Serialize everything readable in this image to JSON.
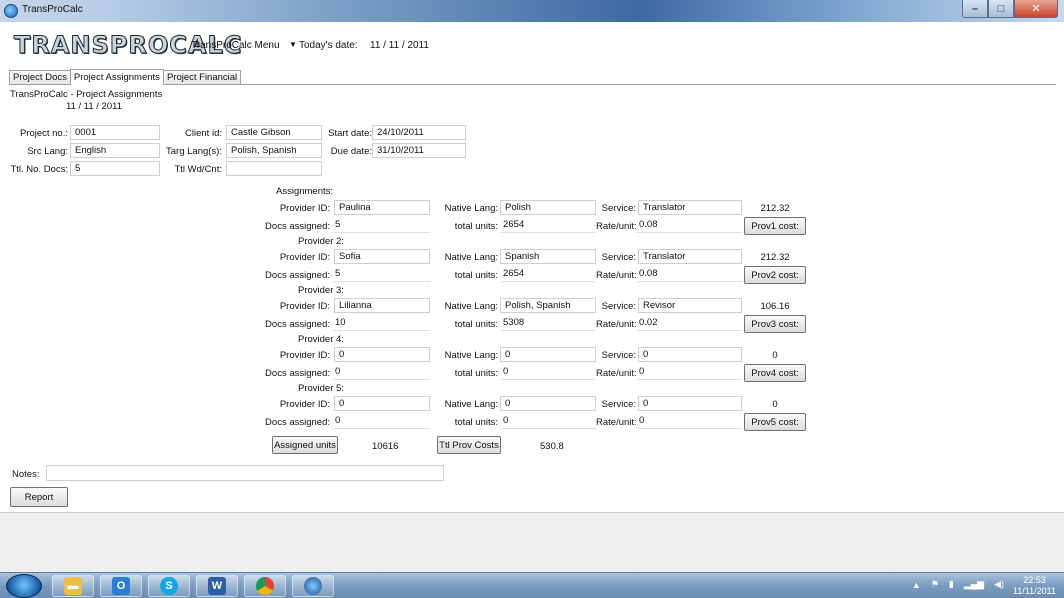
{
  "window": {
    "title": "TransProCalc"
  },
  "header": {
    "logo": "TRANSPROCALC",
    "menu_label": "TransProCalc Menu",
    "today_label": "Today's date:",
    "today_value": "11 / 11 / 2011"
  },
  "tabs": [
    {
      "label": "Project Docs"
    },
    {
      "label": "Project Assignments"
    },
    {
      "label": "Project Financial"
    }
  ],
  "panel": {
    "heading": "TransProCalc - Project Assignments",
    "date": "11 / 11 / 2011"
  },
  "project": {
    "project_no_label": "Project no.:",
    "project_no": "0001",
    "client_id_label": "Client id:",
    "client_id": "Castle Gibson",
    "start_date_label": "Start date:",
    "start_date": "24/10/2011",
    "src_lang_label": "Src Lang:",
    "src_lang": "English",
    "targ_lang_label": "Targ Lang(s):",
    "targ_lang": "Polish, Spanish",
    "due_date_label": "Due date:",
    "due_date": "31/10/2011",
    "ttl_docs_label": "Ttl. No. Docs:",
    "ttl_docs": "5",
    "ttl_wdcnt_label": "Ttl Wd/Cnt:",
    "ttl_wdcnt": ""
  },
  "assignments": {
    "heading": "Assignments:",
    "labels": {
      "provider_id": "Provider ID:",
      "native_lang": "Native Lang:",
      "service": "Service:",
      "docs_assigned": "Docs assigned:",
      "total_units": "total units:",
      "rate_unit": "Rate/unit:"
    },
    "providers": [
      {
        "header": "",
        "provider_id": "Paulina",
        "native_lang": "Polish",
        "service": "Translator",
        "cost": "212.32",
        "docs_assigned": "5",
        "total_units": "2654",
        "rate": "0.08",
        "cost_button": "Prov1 cost:"
      },
      {
        "header": "Provider 2:",
        "provider_id": "Sofia",
        "native_lang": "Spanish",
        "service": "Translator",
        "cost": "212.32",
        "docs_assigned": "5",
        "total_units": "2654",
        "rate": "0.08",
        "cost_button": "Prov2 cost:"
      },
      {
        "header": "Provider 3:",
        "provider_id": "Lilianna",
        "native_lang": "Polish, Spanish",
        "service": "Revisor",
        "cost": "106.16",
        "docs_assigned": "10",
        "total_units": "5308",
        "rate": "0.02",
        "cost_button": "Prov3 cost:"
      },
      {
        "header": "Provider 4:",
        "provider_id": "0",
        "native_lang": "0",
        "service": "0",
        "cost": "0",
        "docs_assigned": "0",
        "total_units": "0",
        "rate": "0",
        "cost_button": "Prov4 cost:"
      },
      {
        "header": "Provider 5:",
        "provider_id": "0",
        "native_lang": "0",
        "service": "0",
        "cost": "0",
        "docs_assigned": "0",
        "total_units": "0",
        "rate": "0",
        "cost_button": "Prov5 cost:"
      }
    ],
    "assigned_units_button": "Assigned units",
    "assigned_units_value": "10616",
    "ttl_prov_costs_button": "Ttl Prov Costs",
    "ttl_prov_costs_value": "530.8"
  },
  "notes": {
    "label": "Notes:",
    "value": ""
  },
  "report_button": "Report",
  "taskbar": {
    "clock_time": "22:53",
    "clock_date": "11/11/2011"
  }
}
